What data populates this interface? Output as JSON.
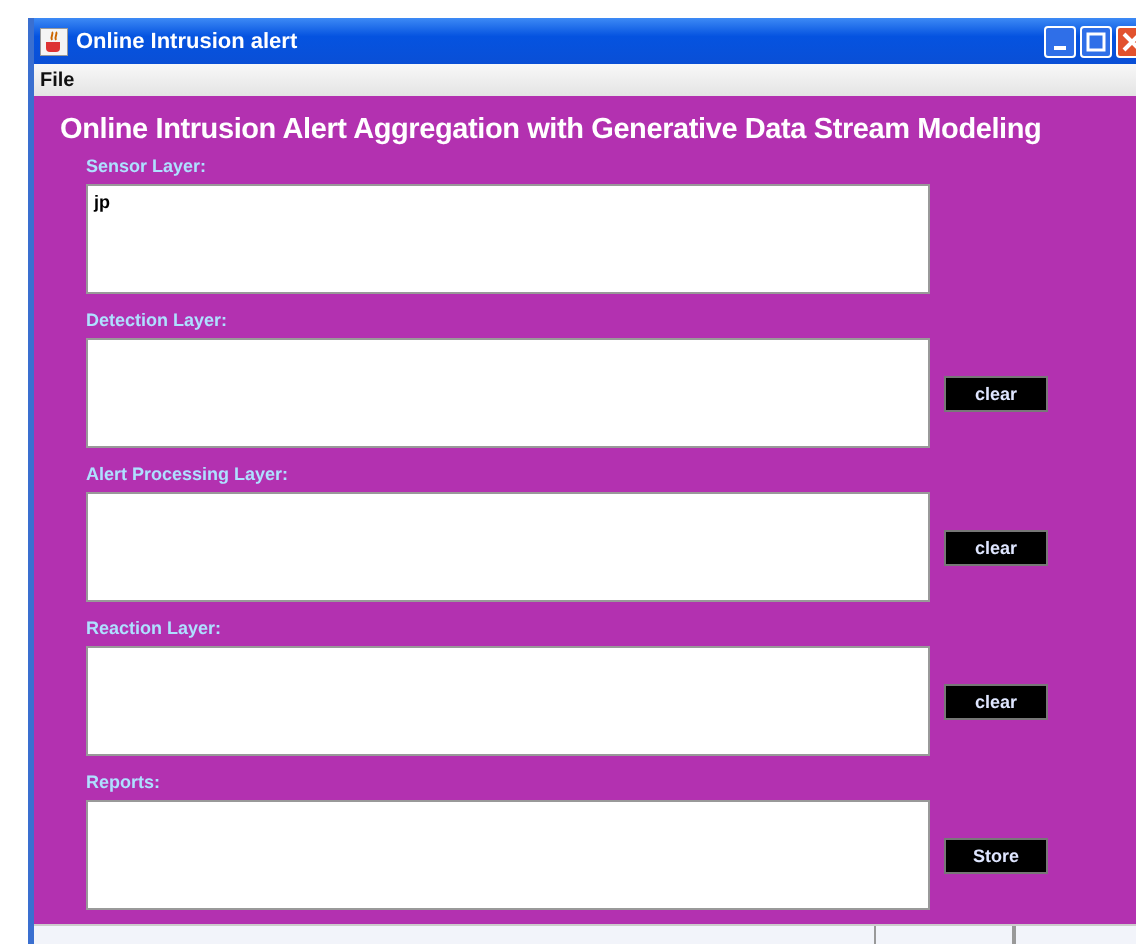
{
  "window": {
    "title": "Online Intrusion alert"
  },
  "menu": [
    "File"
  ],
  "heading": "Online Intrusion Alert Aggregation with Generative Data Stream Modeling",
  "layers": [
    {
      "label": "Sensor Layer:",
      "value": "jp"
    },
    {
      "label": "Detection Layer:",
      "button": "clear"
    },
    {
      "label": "Alert Processing Layer:",
      "button": "clear"
    },
    {
      "label": "Reaction Layer:",
      "button": "clear"
    },
    {
      "label": "Reports:",
      "button": "Store"
    }
  ]
}
